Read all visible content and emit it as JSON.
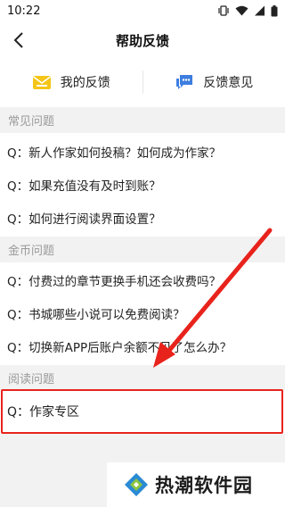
{
  "status_bar": {
    "time": "10:22"
  },
  "nav": {
    "title": "帮助反馈"
  },
  "actions": [
    {
      "label": "我的反馈",
      "icon": "mail-icon"
    },
    {
      "label": "反馈意见",
      "icon": "chat-icon"
    }
  ],
  "sections": [
    {
      "title": "常见问题",
      "questions": [
        "Q：新人作家如何投稿？如何成为作家？",
        "Q：如果充值没有及时到账？",
        "Q：如何进行阅读界面设置？"
      ]
    },
    {
      "title": "金币问题",
      "questions": [
        "Q：付费过的章节更换手机还会收费吗？",
        "Q：书城哪些小说可以免费阅读？",
        "Q：切换新APP后账户余额不见了怎么办？"
      ]
    },
    {
      "title": "阅读问题",
      "questions": [
        "Q：作家专区"
      ]
    }
  ],
  "watermark": {
    "text": "热潮软件园"
  },
  "colors": {
    "accent_yellow": "#f5c518",
    "accent_blue": "#3d7ee0",
    "highlight_red": "#e8231c"
  }
}
